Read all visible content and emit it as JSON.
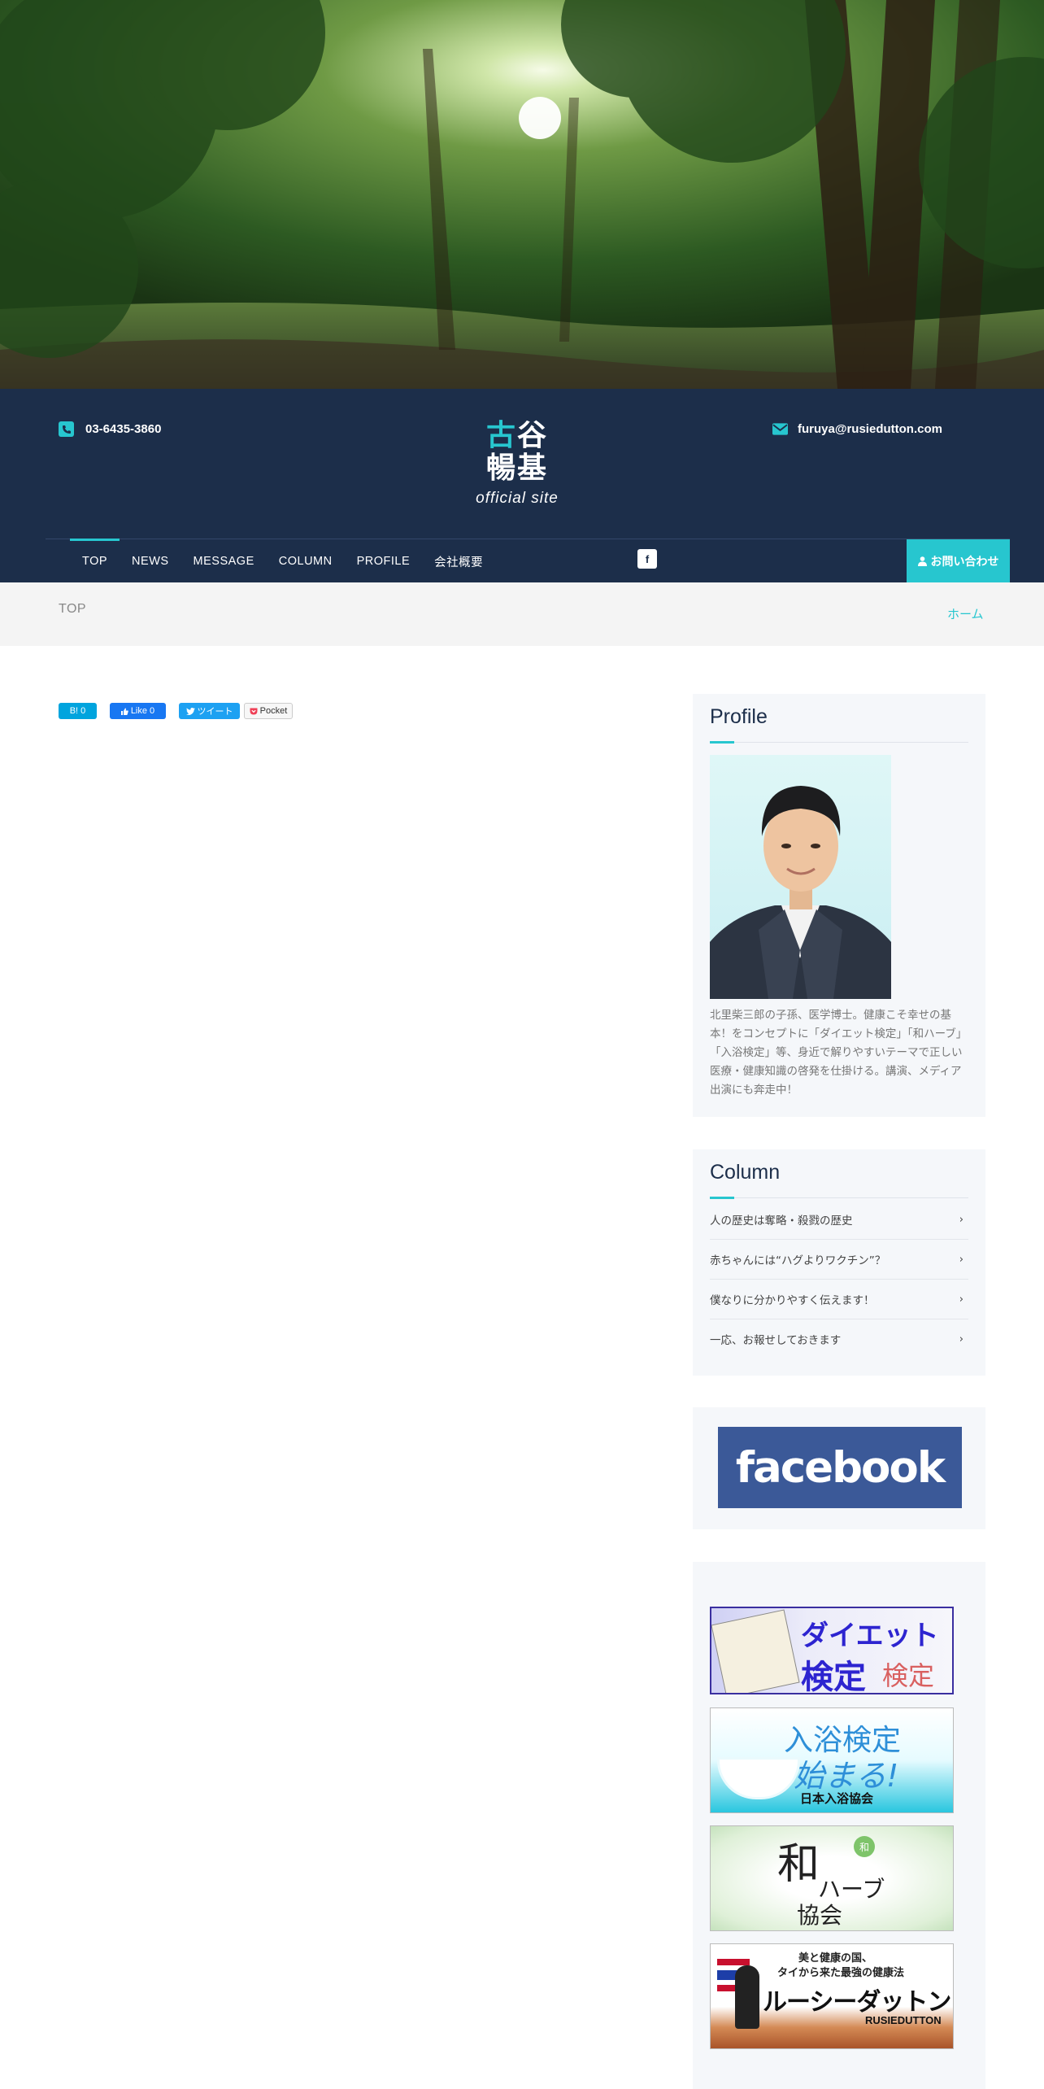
{
  "header": {
    "phone": "03-6435-3860",
    "email": "furuya@rusiedutton.com",
    "logo_accent": "古",
    "logo_rest_line1": "谷",
    "logo_line2": "暢基",
    "logo_sub": "official site"
  },
  "nav": {
    "items": [
      "TOP",
      "NEWS",
      "MESSAGE",
      "COLUMN",
      "PROFILE",
      "会社概要"
    ],
    "facebook_icon_label": "f",
    "contact": "お問い合わせ"
  },
  "breadcrumb": {
    "current": "TOP",
    "home": "ホーム"
  },
  "share": {
    "hatena": "B! 0",
    "like": "Like 0",
    "tweet": "ツイート",
    "pocket": "Pocket"
  },
  "profile": {
    "title": "Profile",
    "bio": "北里柴三郎の子孫、医学博士。健康こそ幸せの基本！をコンセプトに「ダイエット検定」「和ハーブ」「入浴検定」等、身近で解りやすいテーマで正しい医療・健康知識の啓発を仕掛ける。講演、メディア出演にも奔走中！"
  },
  "column": {
    "title": "Column",
    "items": [
      "人の歴史は奪略・殺戮の歴史",
      "赤ちゃんには“ハグよりワクチン”？",
      "僕なりに分かりやすく伝えます！",
      "一応、お報せしておきます"
    ]
  },
  "facebook_banner": "facebook",
  "banners": {
    "diet": {
      "line1": "ダイエット",
      "line2": "検定",
      "mark": "検定"
    },
    "bath": {
      "line1": "入浴検定",
      "line2": "始まる!",
      "org": "日本入浴協会"
    },
    "herb": {
      "big": "和",
      "line1": "ハーブ",
      "line2": "協会",
      "seal": "和"
    },
    "rusie": {
      "line1": "美と健康の国、",
      "line2": "タイから来た最強の健康法",
      "title": "ルーシーダットン",
      "sub": "RUSIEDUTTON"
    }
  },
  "colors": {
    "navy": "#1c2e4a",
    "accent": "#27c6cf",
    "facebook": "#3b5998"
  }
}
